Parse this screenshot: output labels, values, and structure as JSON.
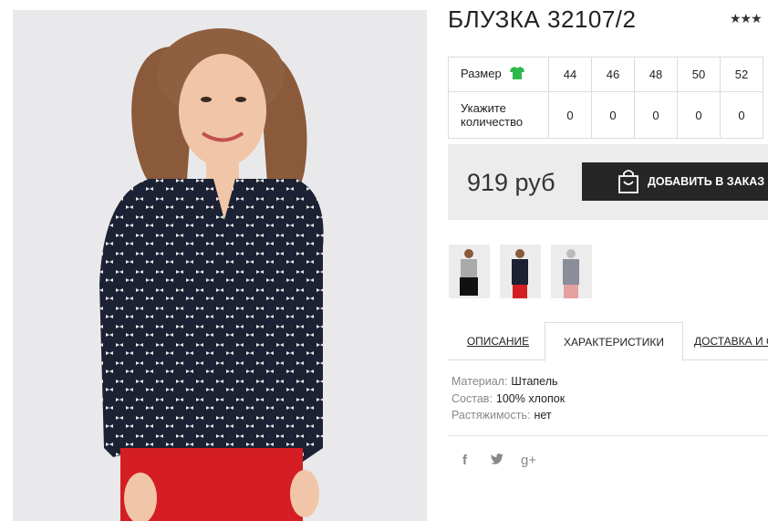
{
  "product": {
    "title": "БЛУЗКА 32107/2",
    "rating_stars": "★★★"
  },
  "size_table": {
    "size_label": "Размер",
    "size_icon": "tshirt-icon",
    "sizes": [
      "44",
      "46",
      "48",
      "50",
      "52"
    ],
    "quantity_label_line1": "Укажите",
    "quantity_label_line2": "количество",
    "quantities": [
      "0",
      "0",
      "0",
      "0",
      "0"
    ]
  },
  "purchase": {
    "price": "919 руб",
    "add_button_label": "ДОБАВИТЬ В ЗАКАЗ",
    "button_icon": "shopping-bag-icon"
  },
  "tabs": [
    {
      "label": "ОПИСАНИЕ",
      "active": false
    },
    {
      "label": "ХАРАКТЕРИСТИКИ",
      "active": true
    },
    {
      "label": "ДОСТАВКА И О",
      "active": false
    }
  ],
  "specs": [
    {
      "key": "Материал:",
      "value": "Штапель"
    },
    {
      "key": "Состав:",
      "value": "100% хлопок"
    },
    {
      "key": "Растяжимость:",
      "value": "нет"
    }
  ],
  "social": {
    "facebook": "f",
    "twitter": "twitter-icon",
    "googleplus": "g+"
  },
  "colors": {
    "accent_green": "#2db84c",
    "button_dark": "#262626",
    "price_box_bg": "#ececec"
  }
}
